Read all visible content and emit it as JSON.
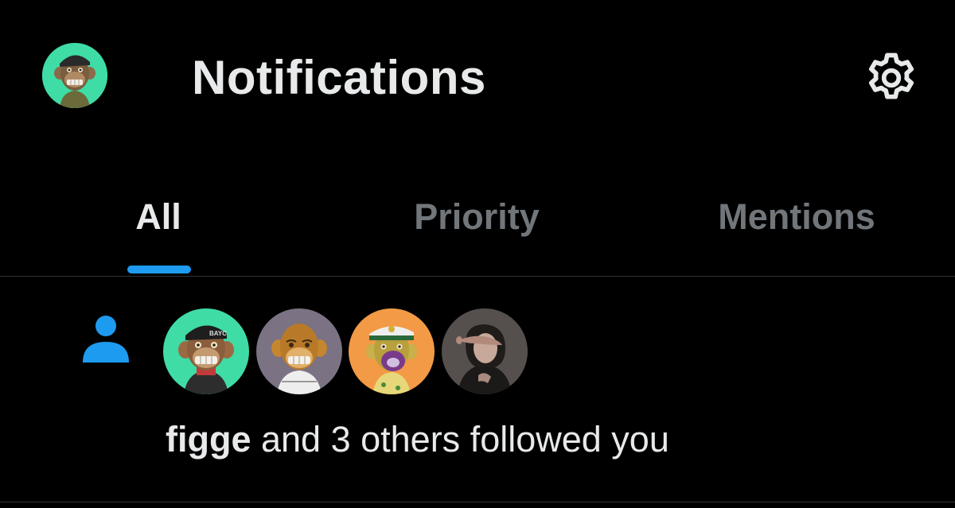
{
  "header": {
    "title": "Notifications",
    "profile_avatar_icon": "ape-avatar-icon",
    "settings_icon": "gear-icon"
  },
  "tabs": [
    {
      "label": "All",
      "active": true
    },
    {
      "label": "Priority",
      "active": false
    },
    {
      "label": "Mentions",
      "active": false
    }
  ],
  "notification": {
    "type_icon": "person-icon",
    "username": "figge",
    "rest_text": " and 3 others followed you",
    "avatars": [
      {
        "icon": "ape-avatar-icon",
        "background": "#3fdca6"
      },
      {
        "icon": "ape-avatar-icon",
        "background": "#7b7283"
      },
      {
        "icon": "ape-avatar-icon",
        "background": "#f29a45"
      },
      {
        "icon": "portrait-avatar-icon",
        "background": "#4a4542"
      }
    ]
  },
  "colors": {
    "background": "#000000",
    "accent": "#1d9bf0",
    "text_primary": "#e7e9ea",
    "text_secondary": "#71767b",
    "divider": "#2f3336"
  }
}
